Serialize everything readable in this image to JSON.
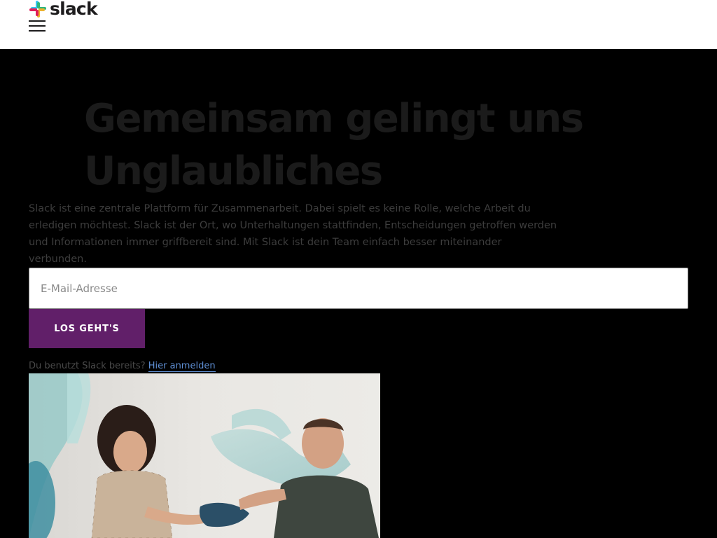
{
  "header": {
    "brand_name": "slack",
    "menu_icon": "hamburger-menu-icon",
    "logo_colors": [
      "#36c5f0",
      "#2eb67d",
      "#ecb22e",
      "#e01e5a"
    ]
  },
  "hero": {
    "headline": "Gemeinsam gelingt uns Unglaubliches",
    "description": "Slack ist eine zentrale Plattform für Zusammenarbeit. Dabei spielt es keine Rolle, welche Arbeit du erledigen möchtest. Slack ist der Ort, wo Unterhaltungen stattfinden, Entscheidungen getroffen werden und Informationen immer griffbereit sind. Mit Slack ist dein Team einfach besser miteinander verbunden.",
    "email_placeholder": "E-Mail-Adresse",
    "email_value": "",
    "cta_label": "LOS GEHT'S",
    "cta_color": "#611f69",
    "signin_prompt": "Du benutzt Slack bereits?",
    "signin_link": "Hier anmelden"
  }
}
